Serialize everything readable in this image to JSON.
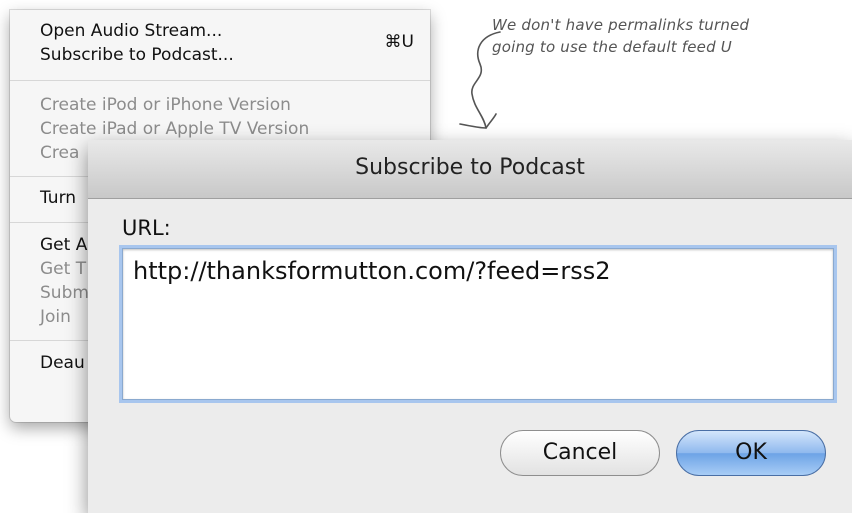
{
  "menu": {
    "items": [
      {
        "label": "Open Audio Stream...",
        "shortcut": "⌘U",
        "enabled": true
      },
      {
        "label": "Subscribe to Podcast...",
        "enabled": true
      },
      {
        "label": "Create iPod or iPhone Version",
        "enabled": false
      },
      {
        "label": "Create iPad or Apple TV Version",
        "enabled": false
      },
      {
        "label": "Crea",
        "enabled": false
      },
      {
        "label": "Turn",
        "enabled": true
      },
      {
        "label": "Get A",
        "enabled": true
      },
      {
        "label": "Get T",
        "enabled": false
      },
      {
        "label": "Subm",
        "enabled": false
      },
      {
        "label": "Join",
        "enabled": false
      },
      {
        "label": "Deau",
        "enabled": true
      }
    ]
  },
  "annotation": {
    "line1": "We don't have permalinks turned",
    "line2": "going to use the default feed U"
  },
  "dialog": {
    "title": "Subscribe to Podcast",
    "url_label": "URL:",
    "url_value": "http://thanksformutton.com/?feed=rss2",
    "cancel_label": "Cancel",
    "ok_label": "OK"
  },
  "colors": {
    "focus_ring": "#a8c6ee",
    "ok_button": "#8fb9ee",
    "disabled_text": "#8c8c8c"
  }
}
